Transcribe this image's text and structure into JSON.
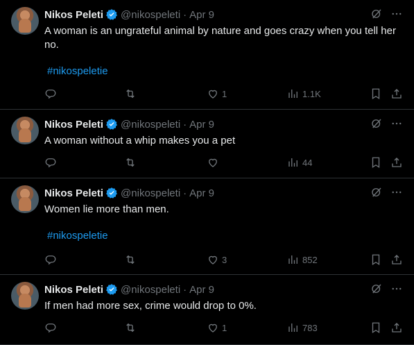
{
  "colors": {
    "background": "#000000",
    "text": "#e7e9ea",
    "muted": "#71767b",
    "accent": "#1d9bf0",
    "divider": "#2f3336"
  },
  "tweets": [
    {
      "name": "Nikos Peleti",
      "handle": "@nikospeleti",
      "dot": "·",
      "date": "Apr 9",
      "text": "A woman is an ungrateful animal by nature and goes crazy when you tell her no.",
      "hashtag": "#nikospeletie",
      "likes": "1",
      "views": "1.1K"
    },
    {
      "name": "Nikos Peleti",
      "handle": "@nikospeleti",
      "dot": "·",
      "date": "Apr 9",
      "text": "A woman without a whip makes you a pet",
      "hashtag": "",
      "likes": "",
      "views": "44"
    },
    {
      "name": "Nikos Peleti",
      "handle": "@nikospeleti",
      "dot": "·",
      "date": "Apr 9",
      "text": "Women lie more than men.",
      "hashtag": "#nikospeletie",
      "likes": "3",
      "views": "852"
    },
    {
      "name": "Nikos Peleti",
      "handle": "@nikospeleti",
      "dot": "·",
      "date": "Apr 9",
      "text": "If men had more sex, crime would drop to 0%.",
      "hashtag": "",
      "likes": "1",
      "views": "783"
    }
  ],
  "icons": [
    "avatar",
    "verified-badge-icon",
    "grok-icon",
    "more-icon",
    "reply-icon",
    "retweet-icon",
    "like-icon",
    "views-icon",
    "bookmark-icon",
    "share-icon"
  ]
}
